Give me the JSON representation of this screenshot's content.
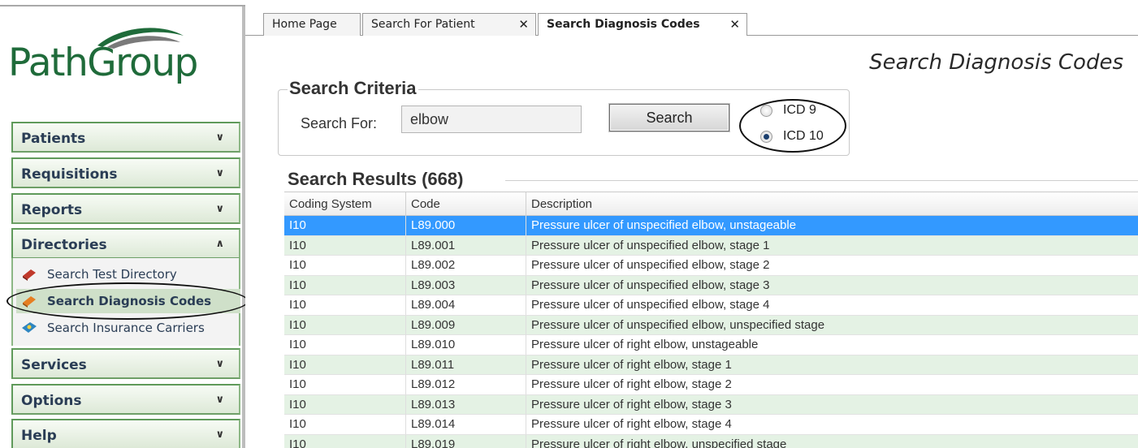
{
  "brand": {
    "logo_text": "PathGroup",
    "green": "#1f6b3a"
  },
  "sidebar": {
    "sections": [
      {
        "label": "Patients",
        "icon": "chevron-double-down-icon",
        "expanded": false
      },
      {
        "label": "Requisitions",
        "icon": "chevron-double-down-icon",
        "expanded": false
      },
      {
        "label": "Reports",
        "icon": "chevron-double-down-icon",
        "expanded": false
      },
      {
        "label": "Directories",
        "icon": "chevron-double-up-icon",
        "expanded": true
      },
      {
        "label": "Services",
        "icon": "chevron-double-down-icon",
        "expanded": false
      },
      {
        "label": "Options",
        "icon": "chevron-double-down-icon",
        "expanded": false
      },
      {
        "label": "Help",
        "icon": "chevron-double-down-icon",
        "expanded": false
      }
    ],
    "directory_items": [
      {
        "label": "Search Test Directory",
        "icon": "book-icon",
        "active": false
      },
      {
        "label": "Search Diagnosis Codes",
        "icon": "book-icon",
        "active": true
      },
      {
        "label": "Search Insurance Carriers",
        "icon": "insurance-card-icon",
        "active": false
      }
    ]
  },
  "tabs": [
    {
      "label": "Home Page",
      "closable": false,
      "active": false
    },
    {
      "label": "Search For Patient",
      "closable": true,
      "active": false
    },
    {
      "label": "Search Diagnosis Codes",
      "closable": true,
      "active": true
    }
  ],
  "tab_close_glyph": "✕",
  "page_title": "Search Diagnosis Codes",
  "criteria": {
    "title": "Search Criteria",
    "search_for_label": "Search For:",
    "search_value": "elbow",
    "search_button": "Search",
    "options": [
      {
        "label": "ICD 9",
        "checked": false
      },
      {
        "label": "ICD 10",
        "checked": true
      }
    ]
  },
  "results": {
    "title": "Search Results (668)",
    "columns": [
      "Coding System",
      "Code",
      "Description"
    ],
    "selected_row": 0,
    "rows": [
      [
        "I10",
        "L89.000",
        "Pressure ulcer of unspecified elbow, unstageable"
      ],
      [
        "I10",
        "L89.001",
        "Pressure ulcer of unspecified elbow, stage 1"
      ],
      [
        "I10",
        "L89.002",
        "Pressure ulcer of unspecified elbow, stage 2"
      ],
      [
        "I10",
        "L89.003",
        "Pressure ulcer of unspecified elbow, stage 3"
      ],
      [
        "I10",
        "L89.004",
        "Pressure ulcer of unspecified elbow, stage 4"
      ],
      [
        "I10",
        "L89.009",
        "Pressure ulcer of unspecified elbow, unspecified stage"
      ],
      [
        "I10",
        "L89.010",
        "Pressure ulcer of right elbow, unstageable"
      ],
      [
        "I10",
        "L89.011",
        "Pressure ulcer of right elbow, stage 1"
      ],
      [
        "I10",
        "L89.012",
        "Pressure ulcer of right elbow, stage 2"
      ],
      [
        "I10",
        "L89.013",
        "Pressure ulcer of right elbow, stage 3"
      ],
      [
        "I10",
        "L89.014",
        "Pressure ulcer of right elbow, stage 4"
      ],
      [
        "I10",
        "L89.019",
        "Pressure ulcer of right elbow, unspecified stage"
      ]
    ]
  },
  "colors": {
    "selection": "#3399ff",
    "alt_row": "#e4f2e4",
    "nav_border": "#5f9a5a"
  }
}
